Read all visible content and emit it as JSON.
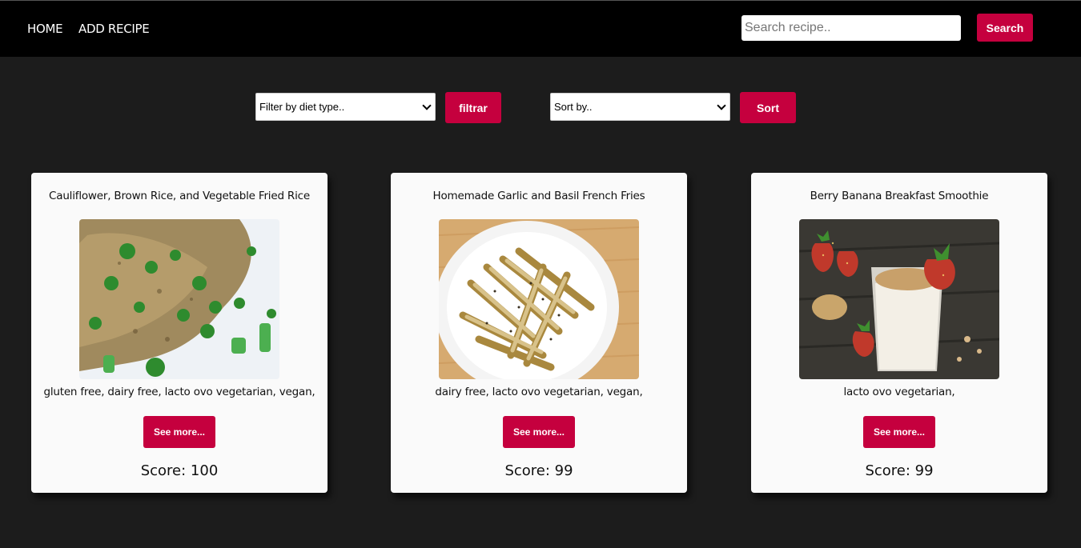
{
  "nav": {
    "home_label": "HOME",
    "add_recipe_label": "ADD RECIPE",
    "search_placeholder": "Search recipe..",
    "search_button": "Search"
  },
  "filters": {
    "diet_select_value": "Filter by diet type..",
    "filter_button": "filtrar",
    "sort_select_value": "Sort by..",
    "sort_button": "Sort"
  },
  "colors": {
    "accent": "#c5003e",
    "background": "#1c1c1c",
    "navbar": "#000000",
    "card": "#fafafa"
  },
  "recipes": [
    {
      "title": "Cauliflower, Brown Rice, and Vegetable Fried Rice",
      "image": "fried-rice-photo",
      "diets": "gluten free, dairy free, lacto ovo vegetarian, vegan,",
      "more_label": "See more...",
      "score": "Score: 100"
    },
    {
      "title": "Homemade Garlic and Basil French Fries",
      "image": "french-fries-photo",
      "diets": "dairy free, lacto ovo vegetarian, vegan,",
      "more_label": "See more...",
      "score": "Score: 99"
    },
    {
      "title": "Berry Banana Breakfast Smoothie",
      "image": "smoothie-photo",
      "diets": "lacto ovo vegetarian,",
      "more_label": "See more...",
      "score": "Score: 99"
    }
  ]
}
